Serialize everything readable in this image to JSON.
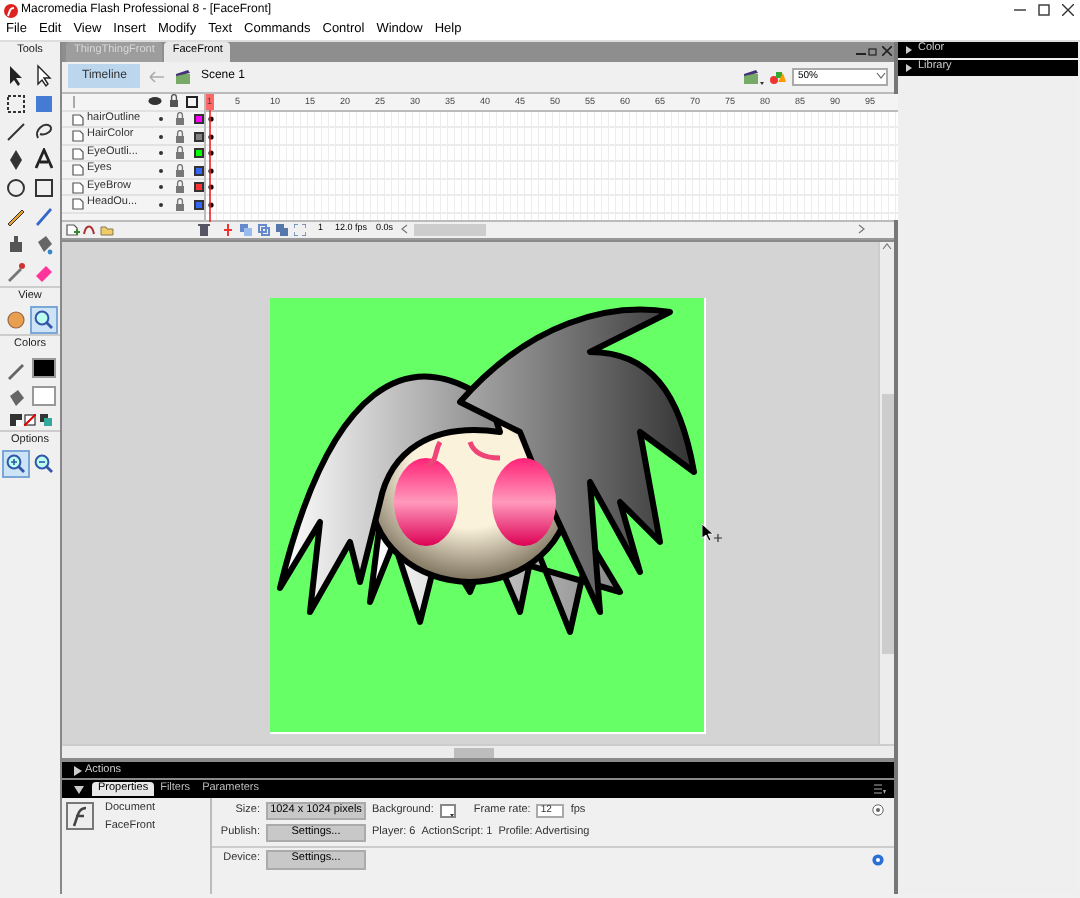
{
  "window": {
    "title": "Macromedia Flash Professional 8 - [FaceFront]"
  },
  "menu": [
    "File",
    "Edit",
    "View",
    "Insert",
    "Modify",
    "Text",
    "Commands",
    "Control",
    "Window",
    "Help"
  ],
  "tools_panel": {
    "title": "Tools",
    "view_label": "View",
    "colors_label": "Colors",
    "options_label": "Options",
    "view_tools": [
      {
        "selected": false
      },
      {
        "selected": true
      }
    ],
    "options": [
      {
        "selected": true
      },
      {
        "selected": false
      }
    ]
  },
  "document_tabs": [
    {
      "label": "ThingThingFront",
      "selected": false
    },
    {
      "label": "FaceFront",
      "selected": true
    }
  ],
  "edit_bar": {
    "timeline_button": "Timeline",
    "scene": "Scene 1",
    "zoom": "50%"
  },
  "timeline": {
    "frame_numbers": [
      "1",
      "5",
      "10",
      "15",
      "20",
      "25",
      "30",
      "35",
      "40",
      "45",
      "50",
      "55",
      "60",
      "65",
      "70",
      "75",
      "80",
      "85",
      "90",
      "95"
    ],
    "layers": [
      {
        "name": "hairOutline",
        "color": "#ff00ff"
      },
      {
        "name": "HairColor",
        "color": "#808080"
      },
      {
        "name": "EyeOutli...",
        "color": "#00ff00"
      },
      {
        "name": "Eyes",
        "color": "#3366ff"
      },
      {
        "name": "EyeBrow",
        "color": "#ff3333"
      },
      {
        "name": "HeadOu...",
        "color": "#3366ff"
      }
    ],
    "current_frame": "1",
    "frame_rate": "12.0 fps",
    "elapsed": "0.0s"
  },
  "actions_panel": {
    "title": "Actions"
  },
  "property_tabs": [
    {
      "label": "Properties",
      "selected": true
    },
    {
      "label": "Filters",
      "selected": false
    },
    {
      "label": "Parameters",
      "selected": false
    }
  ],
  "properties": {
    "type": "Document",
    "name": "FaceFront",
    "size_label": "Size:",
    "size": "1024 x 1024 pixels",
    "background_label": "Background:",
    "frame_rate_label": "Frame rate:",
    "frame_rate": "12",
    "fps": "fps",
    "publish_label": "Publish:",
    "publish_button": "Settings...",
    "player": "Player: 6",
    "actionscript": "ActionScript: 1",
    "profile": "Profile: Advertising",
    "device_label": "Device:",
    "device_button": "Settings..."
  },
  "right_panels": [
    {
      "title": "Color"
    },
    {
      "title": "Library"
    }
  ]
}
